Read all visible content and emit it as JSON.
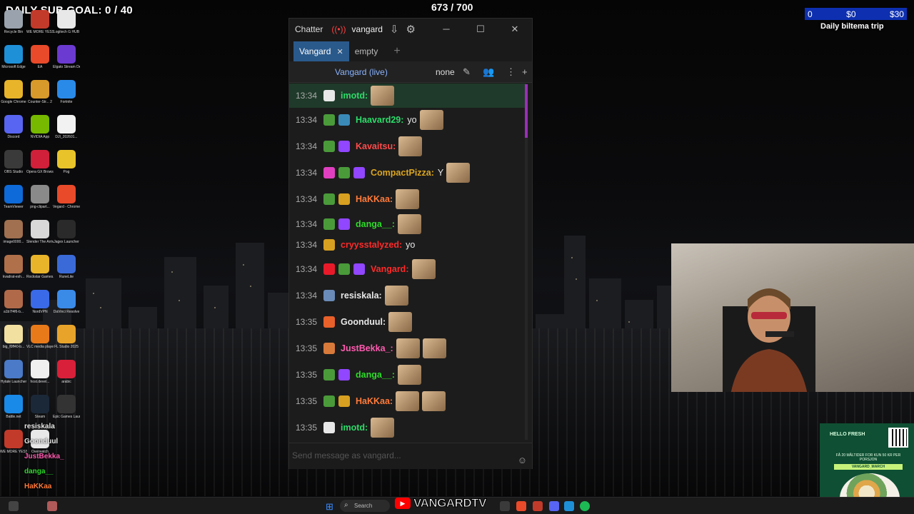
{
  "overlays": {
    "sub_goal": "DAILY SUB GOAL: 0 / 40",
    "viewer_count": "673 / 700",
    "goal_bar": {
      "left": "0",
      "mid": "$0",
      "right": "$30"
    },
    "goal_caption": "Daily biltema trip"
  },
  "desktop_icons": [
    {
      "label": "Recycle Bin",
      "color": "#9aa3ad"
    },
    {
      "label": "WE MORE YESSSSSS",
      "color": "#c23a2a"
    },
    {
      "label": "Logitech G HUB",
      "color": "#e8e8e8"
    },
    {
      "label": "Microsoft Edge",
      "color": "#1e90d8"
    },
    {
      "label": "EA",
      "color": "#e84a2a"
    },
    {
      "label": "Elgato Stream Deck",
      "color": "#6b3ad0"
    },
    {
      "label": "Google Chrome",
      "color": "#e8b42a"
    },
    {
      "label": "Counter-Str... 2",
      "color": "#d89a2a"
    },
    {
      "label": "Fortnite",
      "color": "#2a8ae8"
    },
    {
      "label": "Discord",
      "color": "#5865f2"
    },
    {
      "label": "NVIDIA App",
      "color": "#76b900"
    },
    {
      "label": "DJI_202601...",
      "color": "#f2f2f2"
    },
    {
      "label": "OBS Studio",
      "color": "#3a3a3a"
    },
    {
      "label": "Opera GX Browser",
      "color": "#d0203a"
    },
    {
      "label": "Pog",
      "color": "#e8c42a"
    },
    {
      "label": "TeamViewer",
      "color": "#0e6ad8"
    },
    {
      "label": "png-clipart...",
      "color": "#8a8a8a"
    },
    {
      "label": "Vegard - Chrome",
      "color": "#e84a2a"
    },
    {
      "label": "image0000...",
      "color": "#a07050"
    },
    {
      "label": "Slender The Arrival",
      "color": "#d8d8d8"
    },
    {
      "label": "Jagex Launcher",
      "color": "#2a2a2a"
    },
    {
      "label": "kvadrat-esh...",
      "color": "#b0704a"
    },
    {
      "label": "Rockstar Games...",
      "color": "#e8b42a"
    },
    {
      "label": "RuneLite",
      "color": "#3a6ad8"
    },
    {
      "label": "a1b7f4f6-b...",
      "color": "#b06a4a"
    },
    {
      "label": "NordVPN",
      "color": "#3a6ae8"
    },
    {
      "label": "DaVinci Resolve",
      "color": "#3a8ae8"
    },
    {
      "label": "big_f0ff40-b...",
      "color": "#f2e0a0"
    },
    {
      "label": "VLC media player",
      "color": "#e87a1a"
    },
    {
      "label": "FL Studio 2025",
      "color": "#e8a42a"
    },
    {
      "label": "Hytale Launcher",
      "color": "#4a7ac8"
    },
    {
      "label": "host.devel...",
      "color": "#f0f0f0"
    },
    {
      "label": "arabic",
      "color": "#d8203a"
    },
    {
      "label": "Battle.net",
      "color": "#1a8ae8"
    },
    {
      "label": "Steam",
      "color": "#1b2838"
    },
    {
      "label": "Epic Games Launcher",
      "color": "#333333"
    },
    {
      "label": "WE MORE YESSSSSS",
      "color": "#c23a2a"
    },
    {
      "label": "Overwatch",
      "color": "#e8e8e8"
    }
  ],
  "chatter": {
    "app_name": "Chatter",
    "channel": "vangard",
    "tabs": [
      {
        "label": "Vangard",
        "active": true
      },
      {
        "label": "empty",
        "active": false
      }
    ],
    "channel_header": {
      "name": "Vangard (live)",
      "mode": "none"
    },
    "messages": [
      {
        "time": "13:34",
        "user": "imotd:",
        "color": "#2edb6a",
        "text": "",
        "badges": [
          "#e8e8e8"
        ],
        "emotes": 1,
        "highlight": true
      },
      {
        "time": "13:34",
        "user": "Haavard29:",
        "color": "#2edb6a",
        "text": "yo",
        "badges": [
          "#4a9a3a",
          "#3a8ab8"
        ],
        "emotes": 1,
        "highlight": false
      },
      {
        "time": "13:34",
        "user": "Kavaitsu:",
        "color": "#ff4a4a",
        "text": "",
        "badges": [
          "#4a9a3a",
          "#9146ff"
        ],
        "emotes": 1,
        "highlight": false
      },
      {
        "time": "13:34",
        "user": "CompactPizza:",
        "color": "#daa520",
        "text": "Y",
        "badges": [
          "#e040c0",
          "#4a9a3a",
          "#9146ff"
        ],
        "emotes": 1,
        "highlight": false
      },
      {
        "time": "13:34",
        "user": "HaKKaa:",
        "color": "#ff7a3a",
        "text": "",
        "badges": [
          "#4a9a3a",
          "#d8a020"
        ],
        "emotes": 1,
        "highlight": false
      },
      {
        "time": "13:34",
        "user": "danga__:",
        "color": "#2edb2a",
        "text": "",
        "badges": [
          "#4a9a3a",
          "#9146ff"
        ],
        "emotes": 1,
        "highlight": false
      },
      {
        "time": "13:34",
        "user": "cryysstalyzed:",
        "color": "#ff2a2a",
        "text": "yo",
        "badges": [
          "#d8a020"
        ],
        "emotes": 0,
        "highlight": false
      },
      {
        "time": "13:34",
        "user": "Vangard:",
        "color": "#ff2a2a",
        "text": "",
        "badges": [
          "#e81a2a",
          "#4a9a3a",
          "#9146ff"
        ],
        "emotes": 1,
        "highlight": false
      },
      {
        "time": "13:34",
        "user": "resiskala:",
        "color": "#e8e8e8",
        "text": "",
        "badges": [
          "#6a8ab8"
        ],
        "emotes": 1,
        "highlight": false
      },
      {
        "time": "13:35",
        "user": "Goonduul:",
        "color": "#e8e8e8",
        "text": "",
        "badges": [
          "#e8602a"
        ],
        "emotes": 1,
        "highlight": false
      },
      {
        "time": "13:35",
        "user": "JustBekka_:",
        "color": "#ff5ab0",
        "text": "",
        "badges": [
          "#d87a3a"
        ],
        "emotes": 2,
        "highlight": false
      },
      {
        "time": "13:35",
        "user": "danga__:",
        "color": "#2edb2a",
        "text": "",
        "badges": [
          "#4a9a3a",
          "#9146ff"
        ],
        "emotes": 1,
        "highlight": false
      },
      {
        "time": "13:35",
        "user": "HaKKaa:",
        "color": "#ff7a3a",
        "text": "",
        "badges": [
          "#4a9a3a",
          "#d8a020"
        ],
        "emotes": 2,
        "highlight": false
      },
      {
        "time": "13:35",
        "user": "imotd:",
        "color": "#2edb6a",
        "text": "",
        "badges": [
          "#e8e8e8"
        ],
        "emotes": 1,
        "highlight": false
      }
    ],
    "input_placeholder": "Send message as vangard..."
  },
  "ad": {
    "brand": "HELLO FRESH",
    "offer": "FÅ 20 MÅLTIDER FOR KUN 50 KR PER PORSJON",
    "code": "VANGARD_MARCH"
  },
  "taskbar": {
    "search_placeholder": "Search",
    "channel_brand": "VANGARDTV"
  },
  "side_overlay": [
    {
      "text": "resiskala",
      "color": "#e8e8e8"
    },
    {
      "text": "Goonduul",
      "color": "#e8e8e8"
    },
    {
      "text": "JustBekka_",
      "color": "#ff5ab0"
    },
    {
      "text": "danga__",
      "color": "#2edb2a"
    },
    {
      "text": "HaKKaa",
      "color": "#ff7a3a"
    }
  ]
}
